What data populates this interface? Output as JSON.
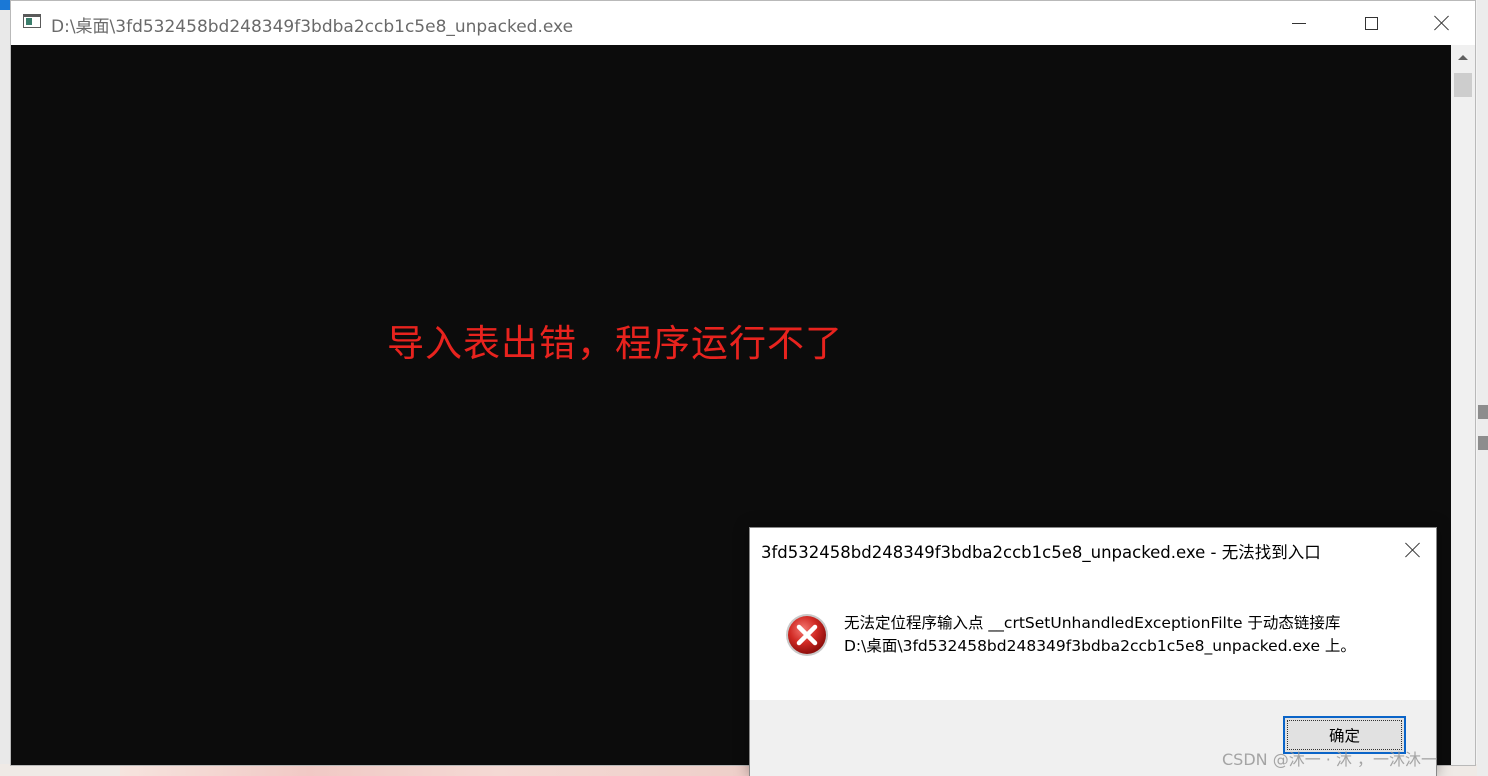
{
  "main_window": {
    "title": "D:\\桌面\\3fd532458bd248349f3bdba2ccb1c5e8_unpacked.exe",
    "icon": "console-app-icon",
    "controls": [
      "minimize-icon",
      "maximize-icon",
      "close-icon"
    ],
    "console_background": "#0c0c0c"
  },
  "annotation": {
    "text": "导入表出错，程序运行不了",
    "color": "#e8231e"
  },
  "dialog": {
    "title": "3fd532458bd248349f3bdba2ccb1c5e8_unpacked.exe - 无法找到入口",
    "icon": "error-icon",
    "message_line1": "无法定位程序输入点 __crtSetUnhandledExceptionFilte 于动态链接库",
    "message_line2": "D:\\桌面\\3fd532458bd248349f3bdba2ccb1c5e8_unpacked.exe 上。",
    "ok_label": "确定",
    "accent": "#0a64c8"
  },
  "watermark": {
    "text": "CSDN @沐一 · 沐 ，一沐沐一"
  }
}
